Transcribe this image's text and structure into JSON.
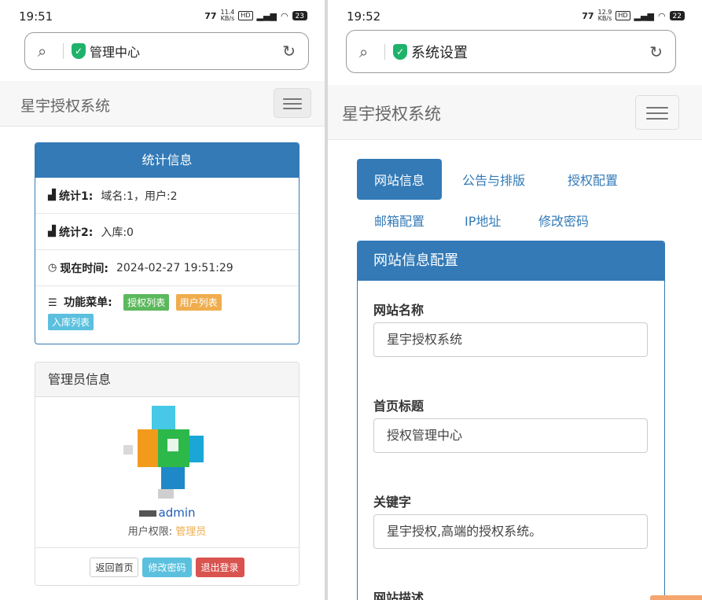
{
  "left": {
    "status_time": "19:51",
    "status_speed_top": "11.4",
    "status_speed_unit": "KB/s",
    "status_battery": "23",
    "address_title": "管理中心",
    "brand": "星宇授权系统",
    "stats": {
      "title": "统计信息",
      "row1_label": "统计1:",
      "row1_value": "域名:1，用户:2",
      "row2_label": "统计2:",
      "row2_value": "入库:0",
      "row3_label": "现在时间:",
      "row3_value": "2024-02-27 19:51:29",
      "menu_label": "功能菜单:",
      "menu_items": [
        "授权列表",
        "用户列表",
        "入库列表"
      ]
    },
    "admin": {
      "title": "管理员信息",
      "username": "admin",
      "role_label": "用户权限:",
      "role_value": "管理员",
      "buttons": [
        "返回首页",
        "修改密码",
        "退出登录"
      ]
    }
  },
  "right": {
    "status_time": "19:52",
    "status_speed_top": "12.9",
    "status_speed_unit": "KB/s",
    "status_battery": "22",
    "address_title": "系统设置",
    "brand": "星宇授权系统",
    "tabs": [
      "网站信息",
      "公告与排版",
      "授权配置",
      "邮箱配置",
      "IP地址",
      "修改密码"
    ],
    "config": {
      "title": "网站信息配置",
      "fields": [
        {
          "label": "网站名称",
          "value": "星宇授权系统"
        },
        {
          "label": "首页标题",
          "value": "授权管理中心"
        },
        {
          "label": "关键字",
          "value": "星宇授权,高端的授权系统。"
        },
        {
          "label": "网站描述",
          "value": ""
        }
      ]
    }
  },
  "colors": {
    "primary": "#337ab7",
    "success": "#5cb85c",
    "warning": "#f0ad4e",
    "info": "#5bc0de",
    "danger": "#d9534f",
    "shield": "#20b26b"
  }
}
